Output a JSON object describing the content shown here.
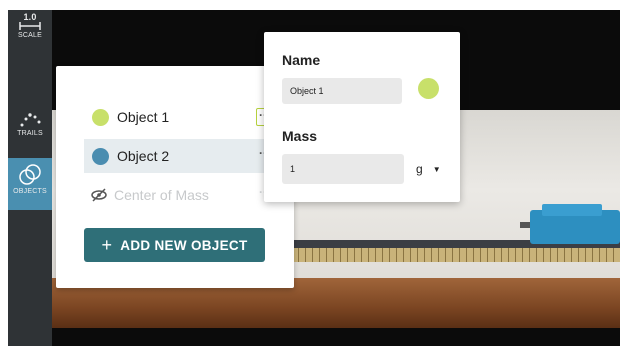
{
  "toolbar": {
    "scale": {
      "value": "1.0",
      "label": "SCALE",
      "icon": "ruler-icon"
    },
    "trails": {
      "label": "TRAILS",
      "icon": "trails-icon"
    },
    "objects": {
      "label": "OBJECTS",
      "icon": "objects-icon",
      "active": true
    }
  },
  "objects_panel": {
    "items": [
      {
        "label": "Object 1",
        "color": "#c8e06a",
        "selected": false,
        "muted": false
      },
      {
        "label": "Object 2",
        "color": "#4a8db0",
        "selected": true,
        "muted": false
      },
      {
        "label": "Center of Mass",
        "icon": "hidden-eye-icon",
        "selected": false,
        "muted": true
      }
    ],
    "more_label": "···",
    "add_button": {
      "plus": "+",
      "label": "ADD NEW OBJECT"
    }
  },
  "properties": {
    "name_heading": "Name",
    "name_value": "Object 1",
    "color": "#c8e06a",
    "mass_heading": "Mass",
    "mass_value": "1",
    "mass_unit": "g",
    "unit_caret": "▼"
  },
  "colors": {
    "accent": "#4a8fb0",
    "button": "#2f6f78",
    "highlight": "#b6d13e"
  }
}
